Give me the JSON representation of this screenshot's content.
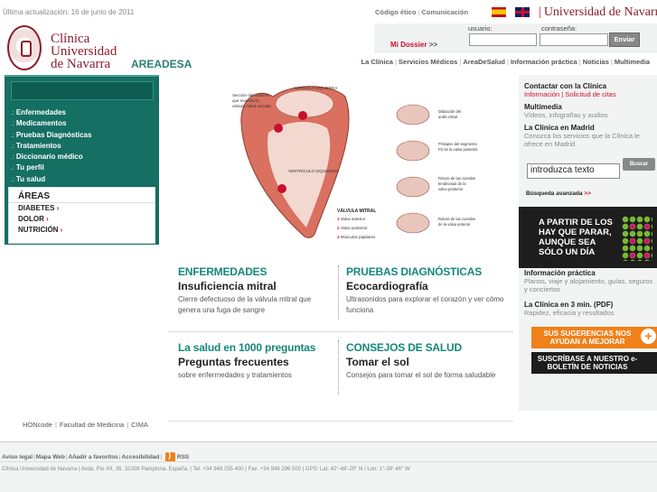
{
  "topbar": {
    "updated": "Última actualización: 16 de junio de 2011",
    "links": [
      "Código ético",
      "Comunicación"
    ],
    "university": "Universidad de Navarra"
  },
  "brand": {
    "line1": "Clínica",
    "line2": "Universidad",
    "line3": "de Navarra",
    "area": "AREADESA"
  },
  "login": {
    "dossier": "Mi Dossier",
    "dossier_arrow": ">>",
    "user_label": "usuario:",
    "pass_label": "contraseña:",
    "send": "Enviar"
  },
  "mainnav": [
    "La Clínica",
    "Servicios Médicos",
    "AreaDeSalud",
    "Información práctica",
    "Noticias",
    "Multimedia"
  ],
  "leftnav": [
    "Enfermedades",
    "Medicamentos",
    "Pruebas Diagnósticas",
    "Tratamientos",
    "Diccionario médico",
    "Tu perfil",
    "Tu salud"
  ],
  "areas": {
    "title": "ÁREAS",
    "items": [
      "DIABETES",
      "DOLOR",
      "NUTRICIÓN"
    ]
  },
  "heart": {
    "callout_top": "Sección del corazón que muestra la válvula mitral cerrada",
    "auricula": "AURÍCULA IZQUIERDA",
    "ventriculo": "VENTRÍCULO IZQUIERDO",
    "legend_title": "VÁLVULA MITRAL",
    "legend": [
      "Valva anterior",
      "Valva posterior",
      "Músculos papilares"
    ],
    "side": [
      "Dilatación del anillo mitral",
      "Prolapso del segmento P2 de la valva posterior",
      "Rotura de las cuerdas tendinosas de la valva posterior",
      "Rotura de las cuerdas de la valva anterior"
    ]
  },
  "articles": [
    {
      "section": "ENFERMEDADES",
      "title": "Insuficiencia mitral",
      "desc": "Cierre defectuoso de la válvula mitral que genera una fuga de sangre"
    },
    {
      "section": "PRUEBAS DIAGNÓSTICAS",
      "title": "Ecocardiografía",
      "desc": "Ultrasonidos para explorar el corazón y ver cómo funciona"
    },
    {
      "section": "La salud en 1000 preguntas",
      "title": "Preguntas frecuentes",
      "desc": "sobre enfermedades y tratamientos"
    },
    {
      "section": "CONSEJOS DE SALUD",
      "title": "Tomar el sol",
      "desc": "Consejos para tomar el sol de forma saludable"
    }
  ],
  "rightcol": {
    "contact_title": "Contactar con la Clínica",
    "contact_links": "Información | Solicitud de citas",
    "multimedia_title": "Multimedia",
    "multimedia_desc": "Vídeos, infografías y audios",
    "madrid_title": "La Clínica en Madrid",
    "madrid_desc": "Conozca los servicios que la Clínica le ofrece en Madrid",
    "search_value": "introduzca texto",
    "search_btn": "Buscar",
    "advanced": "Búsqueda avanzada",
    "advanced_arrow": ">>",
    "banner": "A PARTIR DE LOS HAY QUE PARAR, AUNQUE SEA SÓLO UN DÍA",
    "info_title": "Información práctica",
    "info_desc": "Planos, viaje y alojamiento, guías, seguros y conciertos",
    "three_title": "La Clínica en 3 min. (PDF)",
    "three_desc": "Rapidez, eficacia y resultados",
    "suggest": "SUS SUGERENCIAS NOS AYUDAN A MEJORAR",
    "newsletter": "SUSCRÍBASE A NUESTRO e-BOLETÍN DE NOTICIAS"
  },
  "leftfoot": [
    "HONcode",
    "Facultad de Medicina",
    "CIMA"
  ],
  "footer": {
    "links": [
      "Aviso legal",
      "Mapa Web",
      "Añadir a favoritos",
      "Accesibilidad"
    ],
    "rss": "RSS",
    "address": "Clínica Universidad de Navarra | Avda. Pío XII, 36. 31008 Pamplona. España. | Tel. +34 948 255 400 | Fax. +34 948 296 500 | GPS: Lat: 42°-48'-20'' N / Lon: 1°-39'-46'' W"
  }
}
